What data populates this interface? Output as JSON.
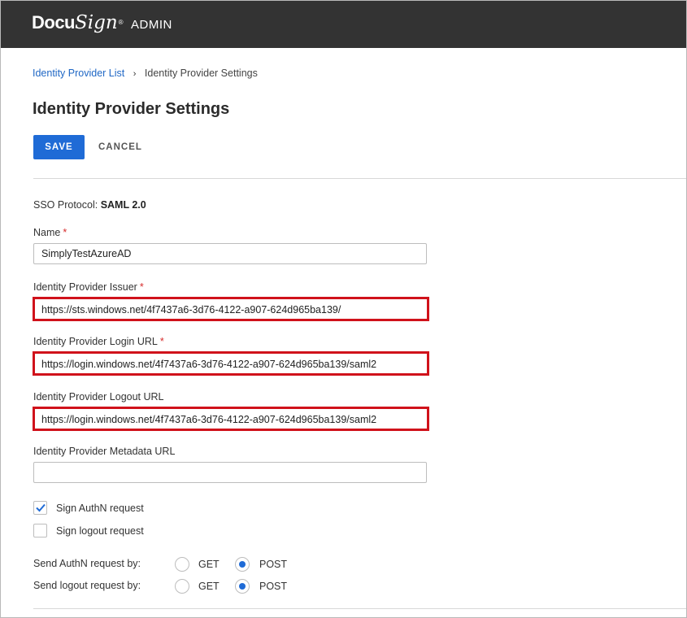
{
  "header": {
    "logo_docu": "Docu",
    "logo_sign": "Sign",
    "logo_reg": "®",
    "section": "ADMIN"
  },
  "breadcrumb": {
    "parent": "Identity Provider List",
    "separator": "›",
    "current": "Identity Provider Settings"
  },
  "page": {
    "title": "Identity Provider Settings"
  },
  "actions": {
    "save": "SAVE",
    "cancel": "CANCEL"
  },
  "sso": {
    "label": "SSO Protocol:",
    "value": "SAML 2.0"
  },
  "form": {
    "name_label": "Name",
    "name_value": "SimplyTestAzureAD",
    "issuer_label": "Identity Provider Issuer",
    "issuer_value": "https://sts.windows.net/4f7437a6-3d76-4122-a907-624d965ba139/",
    "login_label": "Identity Provider Login URL",
    "login_value": "https://login.windows.net/4f7437a6-3d76-4122-a907-624d965ba139/saml2",
    "logout_label": "Identity Provider Logout URL",
    "logout_value": "https://login.windows.net/4f7437a6-3d76-4122-a907-624d965ba139/saml2",
    "metadata_label": "Identity Provider Metadata URL",
    "metadata_value": "",
    "required_mark": "*"
  },
  "options": {
    "sign_authn_label": "Sign AuthN request",
    "sign_authn_checked": true,
    "sign_logout_label": "Sign logout request",
    "sign_logout_checked": false,
    "send_authn_label": "Send AuthN request by:",
    "send_authn_selected": "POST",
    "send_logout_label": "Send logout request by:",
    "send_logout_selected": "POST",
    "method_get": "GET",
    "method_post": "POST"
  },
  "colors": {
    "topbar": "#333333",
    "primary": "#1f6bd6",
    "link": "#1f67c5",
    "highlight": "#d0121b"
  }
}
